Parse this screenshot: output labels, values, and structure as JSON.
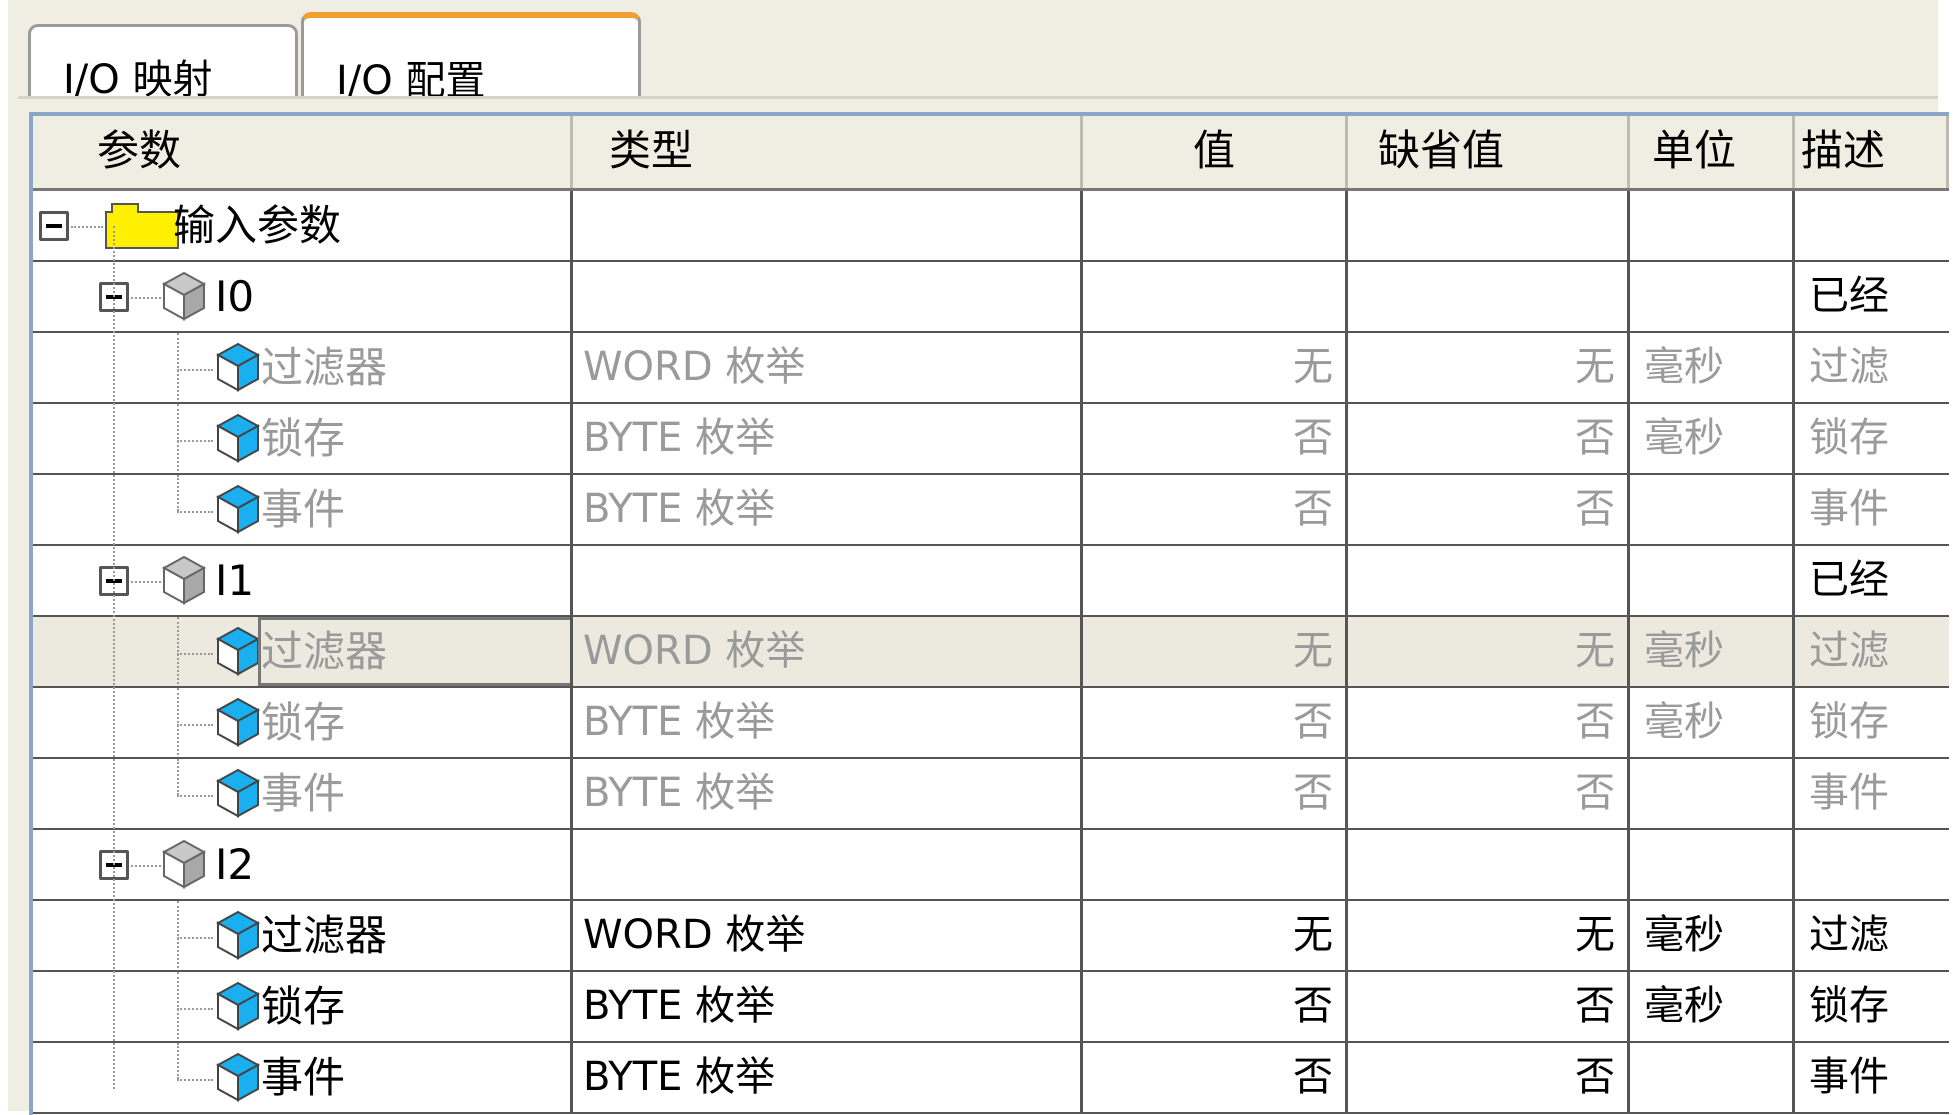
{
  "tabs": [
    {
      "label": "I/O 映射",
      "active": false
    },
    {
      "label": "I/O 配置",
      "active": true
    }
  ],
  "columns": {
    "param": "参数",
    "type": "类型",
    "value": "值",
    "default": "缺省值",
    "unit": "单位",
    "desc": "描述"
  },
  "root": {
    "label": "输入参数"
  },
  "groups": [
    {
      "label": "I0",
      "desc": "已经",
      "children": [
        {
          "label": "过滤器",
          "type": "WORD 枚举",
          "value": "无",
          "default": "无",
          "unit": "毫秒",
          "desc": "过滤"
        },
        {
          "label": "锁存",
          "type": "BYTE 枚举",
          "value": "否",
          "default": "否",
          "unit": "毫秒",
          "desc": "锁存"
        },
        {
          "label": "事件",
          "type": "BYTE 枚举",
          "value": "否",
          "default": "否",
          "unit": "",
          "desc": "事件"
        }
      ]
    },
    {
      "label": "I1",
      "desc": "已经",
      "children": [
        {
          "label": "过滤器",
          "type": "WORD 枚举",
          "value": "无",
          "default": "无",
          "unit": "毫秒",
          "desc": "过滤"
        },
        {
          "label": "锁存",
          "type": "BYTE 枚举",
          "value": "否",
          "default": "否",
          "unit": "毫秒",
          "desc": "锁存"
        },
        {
          "label": "事件",
          "type": "BYTE 枚举",
          "value": "否",
          "default": "否",
          "unit": "",
          "desc": "事件"
        }
      ]
    },
    {
      "label": "I2",
      "desc": "",
      "children": [
        {
          "label": "过滤器",
          "type": "WORD 枚举",
          "value": "无",
          "default": "无",
          "unit": "毫秒",
          "desc": "过滤"
        },
        {
          "label": "锁存",
          "type": "BYTE 枚举",
          "value": "否",
          "default": "否",
          "unit": "毫秒",
          "desc": "锁存"
        },
        {
          "label": "事件",
          "type": "BYTE 枚举",
          "value": "否",
          "default": "否",
          "unit": "",
          "desc": "事件"
        }
      ]
    }
  ],
  "icons": {
    "root": "folder-icon",
    "group": "gray-cube-icon",
    "param": "blue-cube-icon",
    "expander": "collapse-icon"
  },
  "colors": {
    "background": "#f0ede3",
    "active_tab_accent": "#f0a030",
    "folder": "#ffef00",
    "cube_blue": "#1ab0f0",
    "disabled_text": "#9a9a9a",
    "selected_row": "#ece9de"
  }
}
